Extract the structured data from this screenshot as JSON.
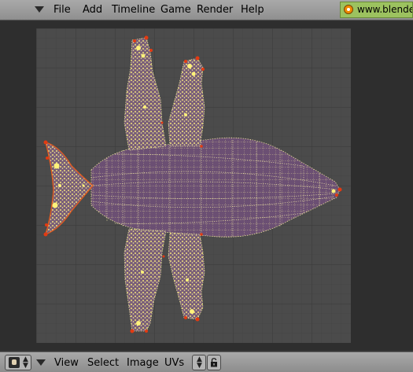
{
  "menubar": {
    "items": [
      "File",
      "Add",
      "Timeline",
      "Game",
      "Render",
      "Help"
    ],
    "url_text": "www.blender"
  },
  "uv_editor": {
    "grid_color": "#4c4c4c",
    "grid_line_color": "#3e3e3e",
    "face_color": "#6b4f73",
    "vertex_color": "#f5e77a",
    "selected_edge_color": "#e03010"
  },
  "header": {
    "menu_items": [
      "View",
      "Select",
      "Image",
      "UVs"
    ],
    "editor_type_icon": "image-editor-icon",
    "lock_icon": "lock-icon"
  }
}
